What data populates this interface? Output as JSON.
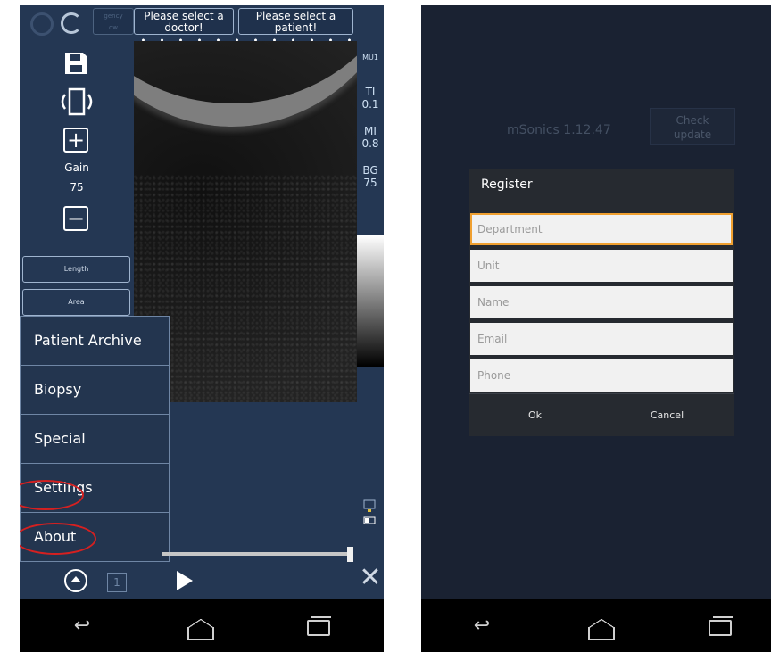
{
  "left_screen": {
    "top_buttons": {
      "emergency_label": "gency\now",
      "doctor_label": "Please select a\ndoctor!",
      "patient_label": "Please select a\npatient!"
    },
    "controls": {
      "gain_label": "Gain",
      "gain_value": "75",
      "length_label": "Length",
      "area_label": "Area"
    },
    "params": {
      "mu": "MU1",
      "ti_label": "TI",
      "ti_value": "0.1",
      "mi_label": "MI",
      "mi_value": "0.8",
      "bg_label": "BG",
      "bg_value": "75"
    },
    "menu": [
      {
        "label": "Patient Archive"
      },
      {
        "label": "Biopsy"
      },
      {
        "label": "Special"
      },
      {
        "label": "Settings"
      },
      {
        "label": "About"
      }
    ],
    "highlighted_items": [
      "Settings",
      "About"
    ],
    "highlight_color": "#d62020",
    "frame_number": "1",
    "background_color": "#243753"
  },
  "right_screen": {
    "version": "mSonics 1.12.47",
    "check_update_label": "Check\nupdate",
    "dialog": {
      "title": "Register",
      "fields": [
        {
          "placeholder": "Department"
        },
        {
          "placeholder": "Unit"
        },
        {
          "placeholder": "Name"
        },
        {
          "placeholder": "Email"
        },
        {
          "placeholder": "Phone"
        }
      ],
      "ok_label": "Ok",
      "cancel_label": "Cancel"
    },
    "focus_color": "#f0a030",
    "background_color": "#1a2232"
  },
  "navbar": {
    "back_icon": "back-arrow-icon",
    "home_icon": "home-icon",
    "recents_icon": "recent-apps-icon"
  }
}
